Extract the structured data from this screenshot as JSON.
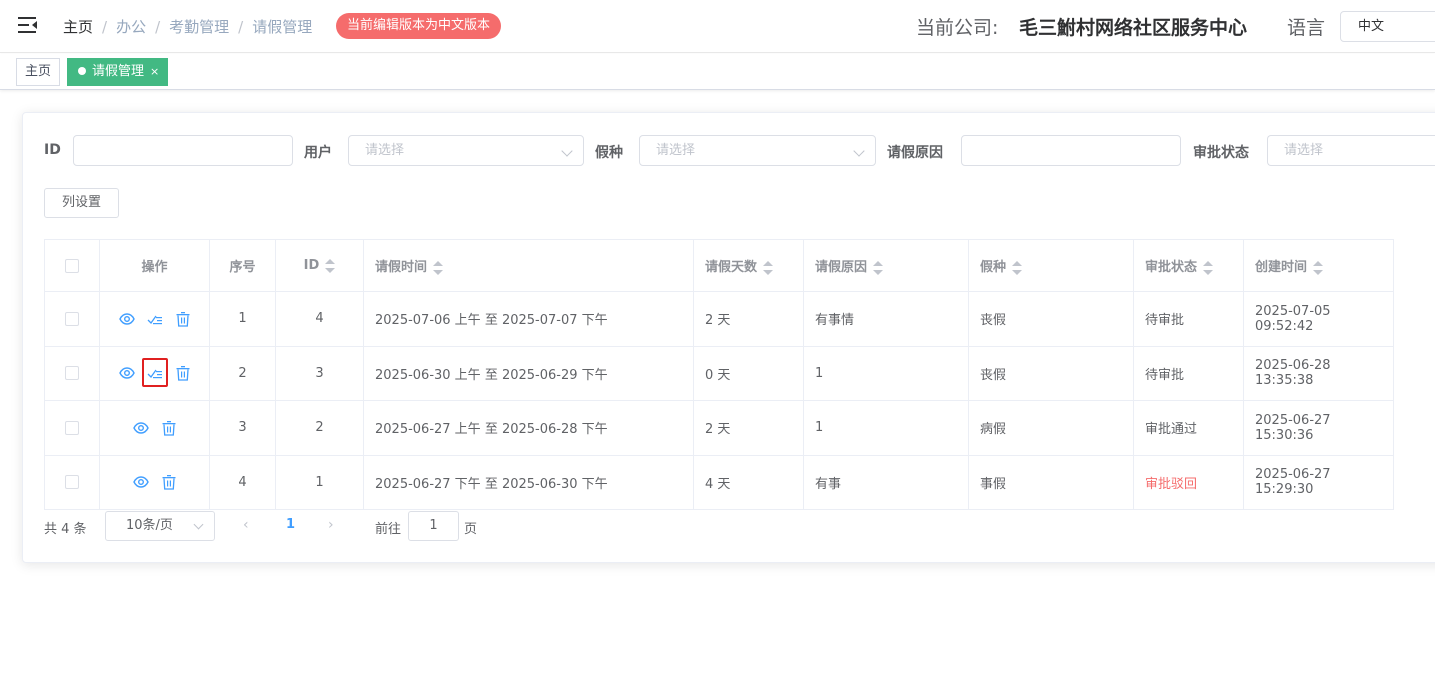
{
  "header": {
    "breadcrumb": [
      "主页",
      "办公",
      "考勤管理",
      "请假管理"
    ],
    "version_badge": "当前编辑版本为中文版本",
    "company_label": "当前公司:",
    "company_name": "毛三鮒村网络社区服务中心",
    "language_label": "语言",
    "language_value": "中文"
  },
  "tags": {
    "home": "主页",
    "active": "请假管理",
    "close": "×"
  },
  "filters": {
    "id_label": "ID",
    "user_label": "用户",
    "user_placeholder": "请选择",
    "leave_type_label": "假种",
    "leave_type_placeholder": "请选择",
    "reason_label": "请假原因",
    "status_label": "审批状态",
    "status_placeholder": "请选择"
  },
  "column_settings_button": "列设置",
  "table": {
    "headers": {
      "ops": "操作",
      "index": "序号",
      "id": "ID",
      "time": "请假时间",
      "days": "请假天数",
      "reason": "请假原因",
      "type": "假种",
      "status": "审批状态",
      "created": "创建时间"
    },
    "rows": [
      {
        "index": "1",
        "id": "4",
        "time": "2025-07-06 上午 至 2025-07-07 下午",
        "days": "2 天",
        "reason": "有事情",
        "type": "丧假",
        "status": "待审批",
        "created": "2025-07-05 09:52:42"
      },
      {
        "index": "2",
        "id": "3",
        "time": "2025-06-30 上午 至 2025-06-29 下午",
        "days": "0 天",
        "reason": "1",
        "type": "丧假",
        "status": "待审批",
        "created": "2025-06-28 13:35:38"
      },
      {
        "index": "3",
        "id": "2",
        "time": "2025-06-27 上午 至 2025-06-28 下午",
        "days": "2 天",
        "reason": "1",
        "type": "病假",
        "status": "审批通过",
        "created": "2025-06-27 15:30:36"
      },
      {
        "index": "4",
        "id": "1",
        "time": "2025-06-27 下午 至 2025-06-30 下午",
        "days": "4 天",
        "reason": "有事",
        "type": "事假",
        "status": "审批驳回",
        "created": "2025-06-27 15:29:30"
      }
    ]
  },
  "pagination": {
    "total": "共 4 条",
    "page_size": "10条/页",
    "prev": "‹",
    "current": "1",
    "next": "›",
    "goto_label": "前往",
    "goto_value": "1",
    "page_label": "页"
  },
  "colors": {
    "accent": "#409eff",
    "tag_active": "#42b983",
    "badge": "#f56c6c",
    "rejected": "#f56c6c"
  }
}
